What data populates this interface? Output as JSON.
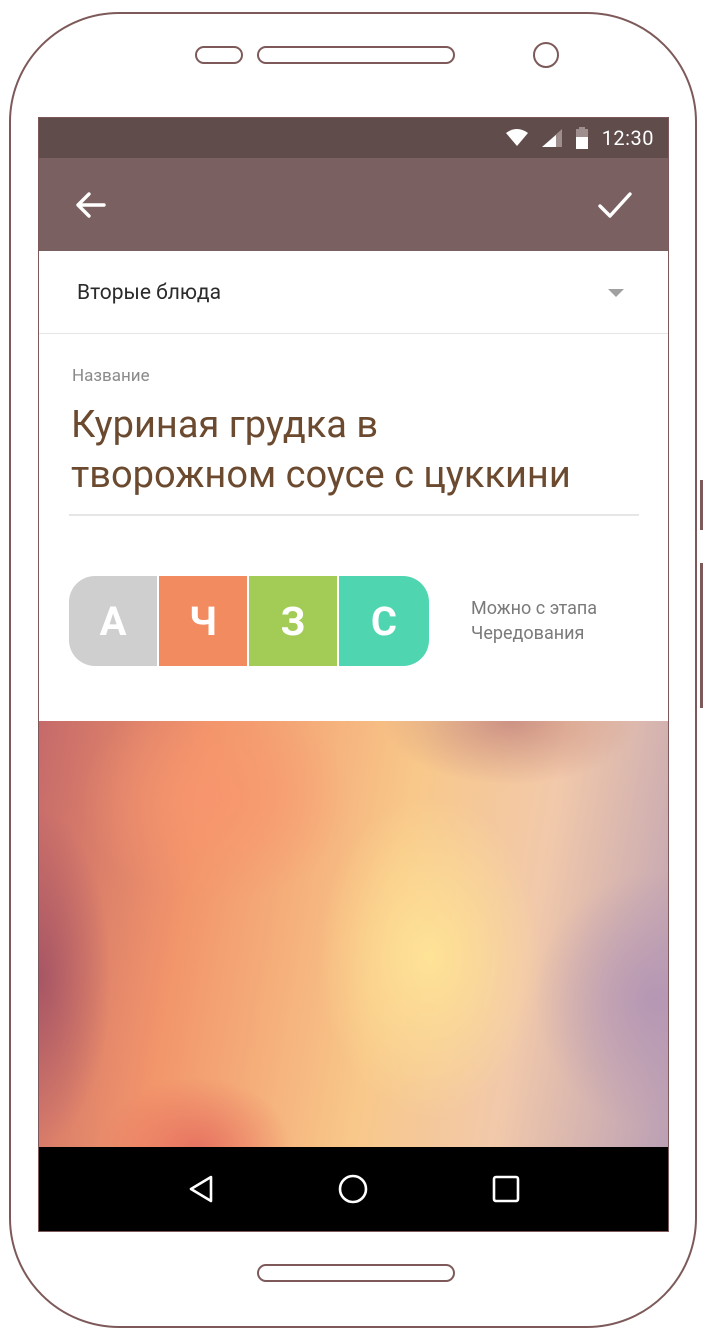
{
  "status": {
    "time": "12:30",
    "icons": [
      "wifi-icon",
      "signal-icon",
      "battery-icon"
    ],
    "bar_color": "#5f4c4b"
  },
  "appbar": {
    "back_icon": "arrow-back-icon",
    "confirm_icon": "check-icon",
    "color": "#7a6060"
  },
  "category": {
    "selected": "Вторые блюда"
  },
  "name_field": {
    "caption": "Название",
    "value_line1": "Куриная грудка в",
    "value_line2": "творожном соусе с цуккини",
    "text_color": "#6b4a2f"
  },
  "phases": {
    "items": [
      {
        "letter": "А",
        "color": "#cfcfcf"
      },
      {
        "letter": "Ч",
        "color": "#f28b5f"
      },
      {
        "letter": "З",
        "color": "#a2cc55"
      },
      {
        "letter": "С",
        "color": "#4fd6b0"
      }
    ],
    "note_line1": "Можно с этапа",
    "note_line2": "Чередования"
  },
  "navbar": {
    "icons": [
      "back-triangle-icon",
      "home-circle-icon",
      "recents-square-icon"
    ]
  }
}
